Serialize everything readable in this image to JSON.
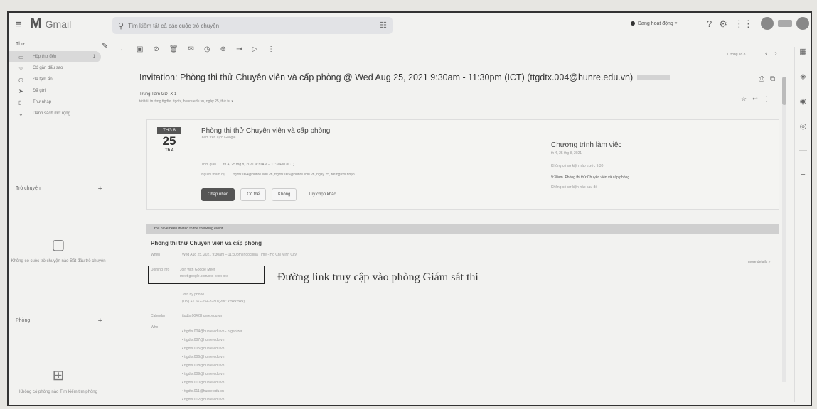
{
  "app": {
    "logo_text": "Gmail",
    "logo_mark": "M"
  },
  "search": {
    "placeholder": "Tìm kiếm tất cả các cuộc trò chuyện"
  },
  "status": {
    "label": "Đang hoạt động ▾"
  },
  "sidebar": {
    "mail_label": "Thư",
    "items": [
      {
        "label": "Hộp thư đến",
        "count": "1"
      },
      {
        "label": "Có gắn dấu sao",
        "count": ""
      },
      {
        "label": "Đã tạm ẩn",
        "count": ""
      },
      {
        "label": "Đã gửi",
        "count": ""
      },
      {
        "label": "Thư nháp",
        "count": ""
      },
      {
        "label": "Danh sách mở rộng",
        "count": ""
      }
    ],
    "chat_label": "Trò chuyện",
    "chat_empty": "Không có cuộc trò chuyện nào Bắt đầu trò chuyện",
    "rooms_label": "Phòng",
    "rooms_empty": "Không có phòng nào Tìm kiếm tìm phòng"
  },
  "email": {
    "subject": "Invitation: Phòng thi thử Chuyên viên và cấp phòng @ Wed Aug 25, 2021 9:30am - 11:30pm (ICT) (ttgdtx.004@hunre.edu.vn)",
    "sender": "Trung Tâm GDTX 1",
    "to_line": "tới tôi, trường ttgdtx, ttgdtx, hunre.edu.vn, ngày 25, thứ tư ▾"
  },
  "invite": {
    "dow": "THG 8",
    "day": "25",
    "weekday": "Th 4",
    "title": "Phòng thi thử Chuyên viên và cấp phòng",
    "subtitle": "Xem trên Lịch Google",
    "when_label": "Thời gian",
    "when": "th 4, 25 thg 8, 2021 9:30AM – 11:30PM (ICT)",
    "guests_label": "Người tham dự",
    "guests": "ttgdtx.004@hunre.edu.vn, ttgdtx.005@hunre.edu.vn, ngày 25, tới người nhận…",
    "rsvp": {
      "yes": "Chấp nhận",
      "maybe": "Có thể",
      "no": "Không",
      "other": "Tùy chọn khác"
    },
    "agenda_title": "Chương trình làm việc",
    "agenda_date": "th 4, 25 thg 8, 2021",
    "agenda_before": "Không có sự kiện nào trước 9:30",
    "agenda_time": "9:30am",
    "agenda_event": "Phòng thi thử Chuyên viên và cấp phòng",
    "agenda_after": "Không có sự kiện nào sau đó"
  },
  "body": {
    "banner": "You have been invited to the following event.",
    "title": "Phòng thi thử Chuyên viên và cấp phòng",
    "when_label": "When",
    "when": "Wed Aug 25, 2021 9:30am – 11:30pm Indochina Time - Ho Chi Minh City",
    "join_label": "Joining info",
    "join_line1": "Join with Google Meet",
    "join_line2": "meet.google.com/xxx-xxxx-xxx",
    "more_details": "more details »",
    "phone_label": "Join by phone",
    "phone": "(US) +1 662-254-8280 (PIN: xxxxxxxxx)",
    "calendar_label": "Calendar",
    "calendar": "ttgdtx.004@hunre.edu.vn",
    "who_label": "Who",
    "guests": [
      "ttgdtx.004@hunre.edu.vn - organizer",
      "ttgdtx.007@hunre.edu.vn",
      "ttgdtx.005@hunre.edu.vn",
      "ttgdtx.006@hunre.edu.vn",
      "ttgdtx.008@hunre.edu.vn",
      "ttgdtx.009@hunre.edu.vn",
      "ttgdtx.010@hunre.edu.vn",
      "ttgdtx.011@hunre.edu.vn",
      "ttgdtx.012@hunre.edu.vn",
      "ttgdtx.013@hunre.edu.vn",
      "ttgdtx.014@hunre.edu.vn"
    ]
  },
  "annotation": "Đường link truy cập vào phòng Giám sát thi",
  "pager": "1 trong số 8"
}
